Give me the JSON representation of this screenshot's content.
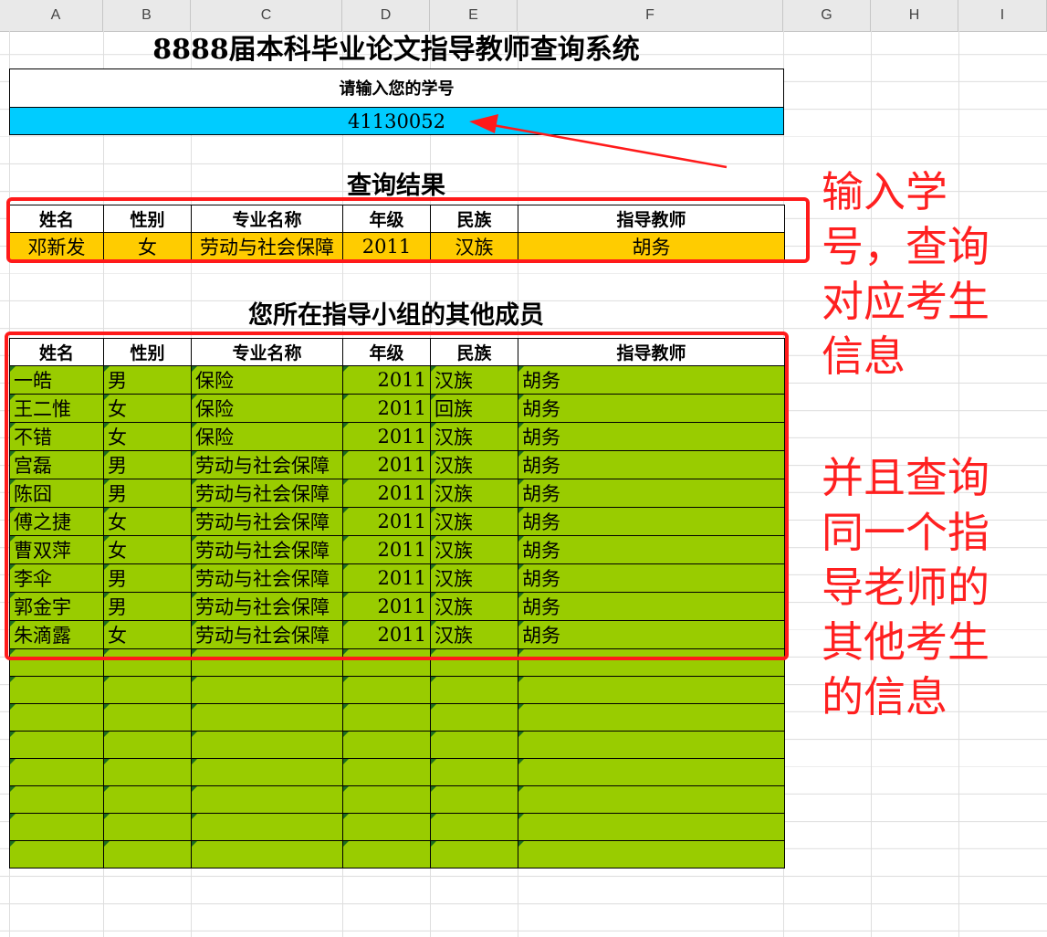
{
  "columns": [
    "A",
    "B",
    "C",
    "D",
    "E",
    "F",
    "G",
    "H",
    "I"
  ],
  "title": "8888届本科毕业论文指导教师查询系统",
  "prompt": "请输入您的学号",
  "student_id": "41130052",
  "result_title": "查询结果",
  "headers": [
    "姓名",
    "性别",
    "专业名称",
    "年级",
    "民族",
    "指导教师"
  ],
  "result_row": [
    "邓新发",
    "女",
    "劳动与社会保障",
    "2011",
    "汉族",
    "胡务"
  ],
  "group_title": "您所在指导小组的其他成员",
  "group_rows": [
    [
      "一皓",
      "男",
      "保险",
      "2011",
      "汉族",
      "胡务"
    ],
    [
      "王二惟",
      "女",
      "保险",
      "2011",
      "回族",
      "胡务"
    ],
    [
      "不错",
      "女",
      "保险",
      "2011",
      "汉族",
      "胡务"
    ],
    [
      "宫磊",
      "男",
      "劳动与社会保障",
      "2011",
      "汉族",
      "胡务"
    ],
    [
      "陈囧",
      "男",
      "劳动与社会保障",
      "2011",
      "汉族",
      "胡务"
    ],
    [
      "傅之捷",
      "女",
      "劳动与社会保障",
      "2011",
      "汉族",
      "胡务"
    ],
    [
      "曹双萍",
      "女",
      "劳动与社会保障",
      "2011",
      "汉族",
      "胡务"
    ],
    [
      "李伞",
      "男",
      "劳动与社会保障",
      "2011",
      "汉族",
      "胡务"
    ],
    [
      "郭金宇",
      "男",
      "劳动与社会保障",
      "2011",
      "汉族",
      "胡务"
    ],
    [
      "朱滴露",
      "女",
      "劳动与社会保障",
      "2011",
      "汉族",
      "胡务"
    ]
  ],
  "empty_rows": 8,
  "annotations": {
    "note_1": "输入学号，查询对应考生信息",
    "note_2": "并且查询同一个指导老师的其他考生的信息"
  },
  "colors": {
    "input_bg": "#00ccff",
    "result_bg": "#ffcc00",
    "group_bg": "#99cc00",
    "annotation": "#ff2020"
  }
}
